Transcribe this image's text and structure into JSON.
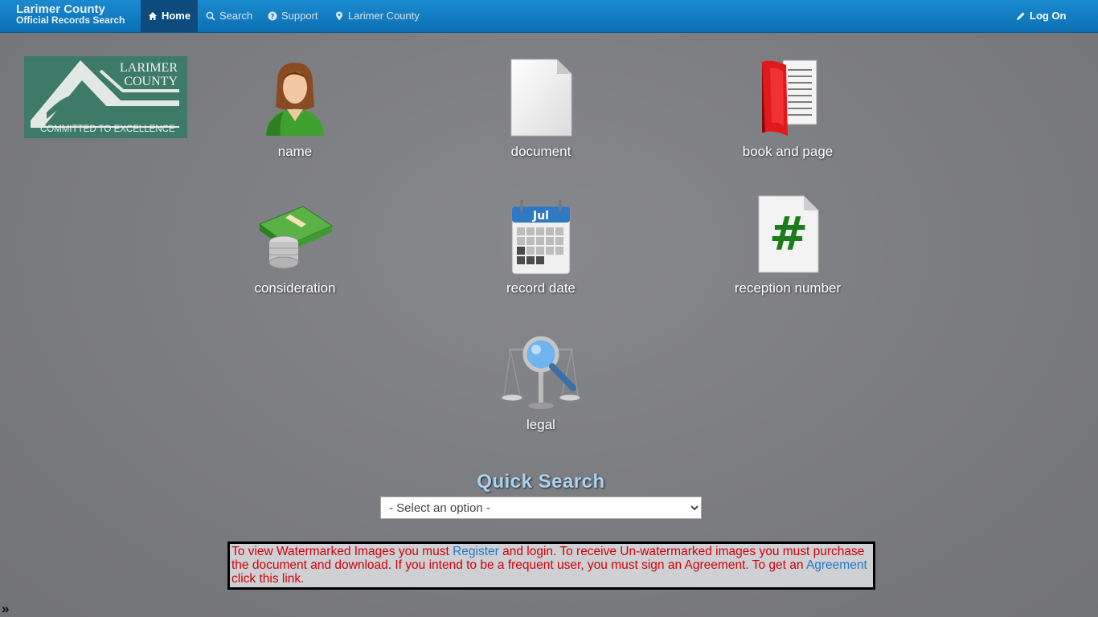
{
  "brand": {
    "line1": "Larimer County",
    "line2": "Official Records Search"
  },
  "nav": {
    "home": "Home",
    "search": "Search",
    "support": "Support",
    "county": "Larimer County",
    "logon": "Log On"
  },
  "logo": {
    "line1": "LARIMER",
    "line2": "COUNTY",
    "tagline": "COMMITTED TO EXCELLENCE"
  },
  "tiles": {
    "name": "name",
    "document": "document",
    "book_and_page": "book and page",
    "consideration": "consideration",
    "record_date": "record date",
    "calendar_month": "Jul",
    "reception_number": "reception number",
    "hash_symbol": "#",
    "legal": "legal"
  },
  "quick_search": {
    "title": "Quick Search",
    "selected": "- Select an option -"
  },
  "notice": {
    "part1": "To view Watermarked Images you must ",
    "register_link": "Register",
    "part2": " and login. To receive Un-watermarked images you must purchase the document and download. If you intend to be a frequent user, you must sign an Agreement. To get an ",
    "agreement_link": "Agreement",
    "part3": " click this link."
  },
  "collapse_toggle": "»",
  "colors": {
    "nav_blue": "#0c6fb3",
    "nav_active": "#0d4b7d",
    "notice_red": "#d0000a",
    "link_blue": "#1d7bc9"
  }
}
